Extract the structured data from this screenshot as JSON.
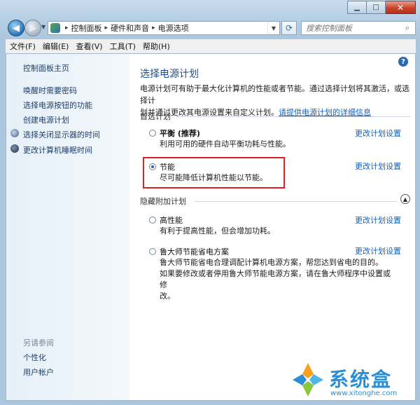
{
  "address": {
    "crumbs": [
      "控制面板",
      "硬件和声音",
      "电源选项"
    ]
  },
  "search": {
    "placeholder": "搜索控制面板"
  },
  "menu": [
    "文件(F)",
    "编辑(E)",
    "查看(V)",
    "工具(T)",
    "帮助(H)"
  ],
  "sidebar": {
    "home": "控制面板主页",
    "links": [
      "唤醒时需要密码",
      "选择电源按钮的功能",
      "创建电源计划",
      "选择关闭显示器的时间",
      "更改计算机睡眠时间"
    ],
    "see_also_title": "另请参阅",
    "see_also": [
      "个性化",
      "用户帐户"
    ]
  },
  "main": {
    "title": "选择电源计划",
    "desc_line1": "电源计划可有助于最大化计算机的性能或者节能。通过选择计划将其激活，或选择计",
    "desc_line2": "划并通过更改其电源设置来自定义计划。",
    "desc_link": "请提供电源计划的详细信息",
    "preferred_title": "首选计划",
    "hidden_title": "隐藏附加计划",
    "change_label": "更改计划设置",
    "plans": [
      {
        "name": "平衡 (推荐)",
        "desc": "利用可用的硬件自动平衡功耗与性能。",
        "selected": false
      },
      {
        "name": "节能",
        "desc": "尽可能降低计算机性能以节能。",
        "selected": true
      },
      {
        "name": "高性能",
        "desc": "有利于提高性能，但会增加功耗。",
        "selected": false
      },
      {
        "name": "鲁大师节能省电方案",
        "desc_lines": [
          "鲁大师节能省电合理调配计算机电源方案，帮您达到省电的目的。",
          "如果要修改或者停用鲁大师节能电源方案，请在鲁大师程序中设置或修",
          "改。"
        ],
        "selected": false
      }
    ]
  },
  "watermark": {
    "name": "系统盒",
    "url": "www.xitonghe.com"
  },
  "colors": {
    "link": "#1460b8",
    "title": "#1d4f8a",
    "highlight": "#e02020"
  }
}
